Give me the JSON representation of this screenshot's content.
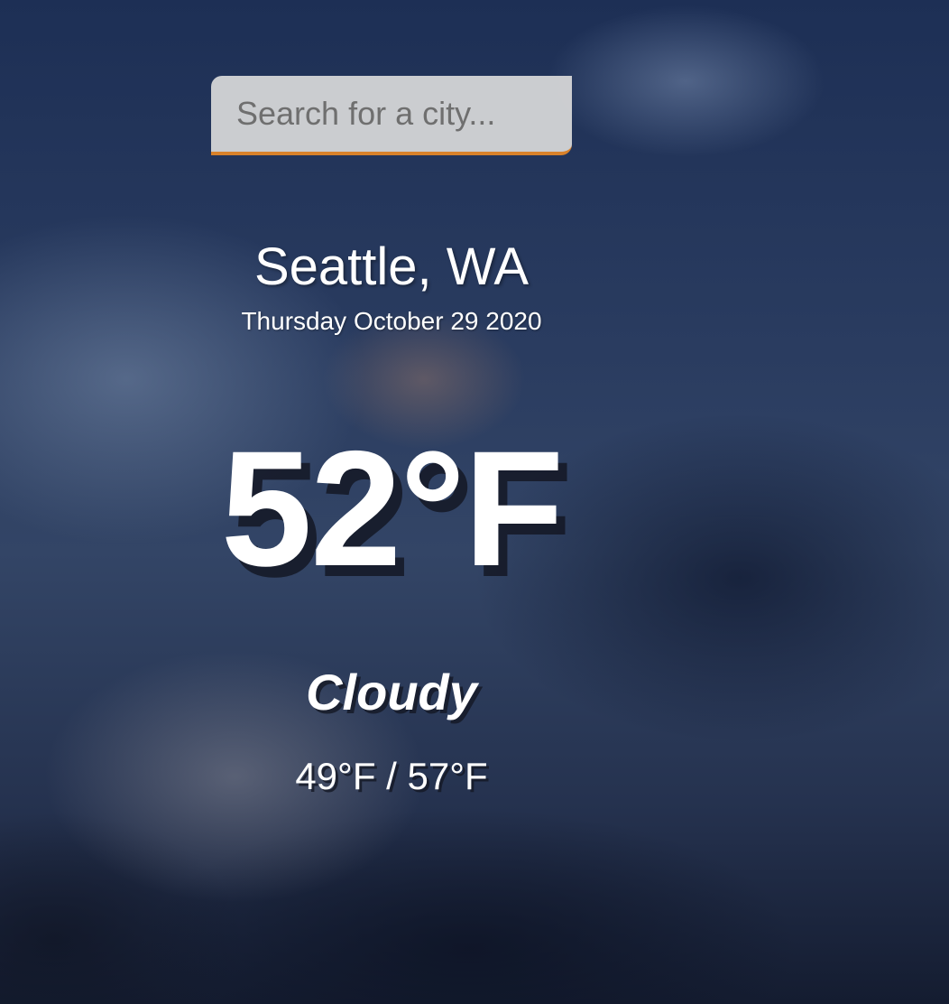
{
  "search": {
    "placeholder": "Search for a city...",
    "accent_color": "#d9822b"
  },
  "location": {
    "city": "Seattle, WA",
    "date": "Thursday October 29 2020"
  },
  "weather": {
    "temperature": "52°F",
    "condition": "Cloudy",
    "hi_low": "49°F / 57°F"
  }
}
